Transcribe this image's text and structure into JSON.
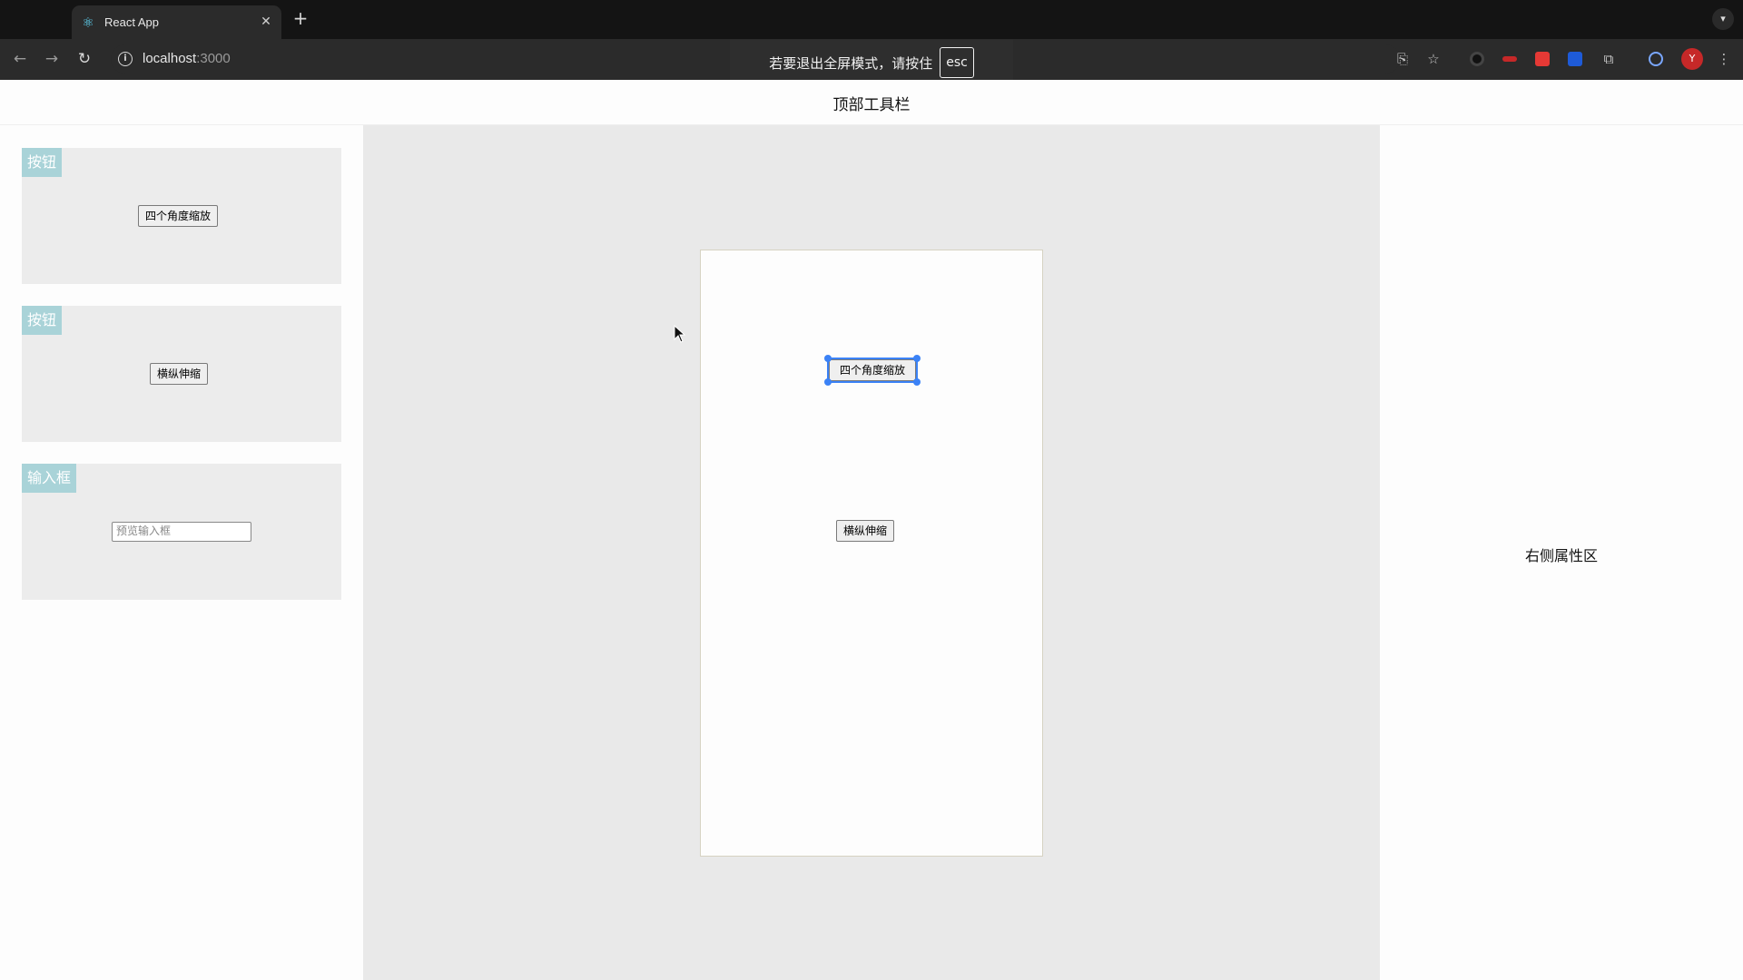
{
  "browser": {
    "tab_title": "React App",
    "url_host": "localhost",
    "url_port": ":3000",
    "profile_initial": "Y",
    "fullscreen_notice": "若要退出全屏模式，请按住",
    "fullscreen_key": "esc"
  },
  "app": {
    "top_toolbar_title": "顶部工具栏",
    "right_panel_title": "右侧属性区"
  },
  "component_library": [
    {
      "tag": "按钮",
      "preview_label": "四个角度缩放"
    },
    {
      "tag": "按钮",
      "preview_label": "横纵伸缩"
    },
    {
      "tag": "输入框",
      "preview_placeholder": "预览输入框"
    }
  ],
  "canvas": {
    "selected_button_label": "四个角度缩放",
    "button_label": "横纵伸缩"
  },
  "colors": {
    "selection": "#3b82f6",
    "tag_bg": "#a9d3d8"
  }
}
